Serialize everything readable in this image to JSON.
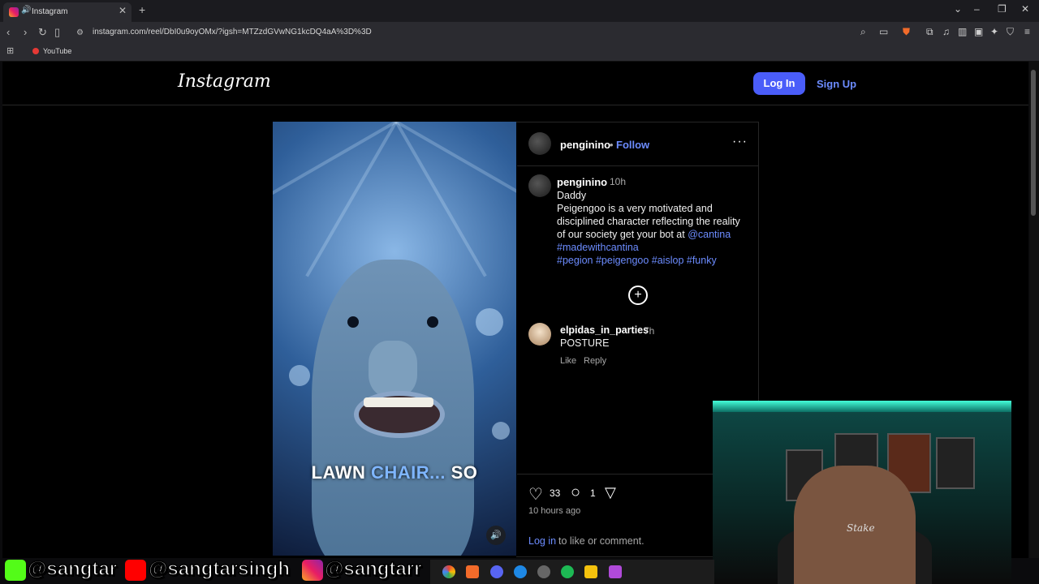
{
  "browser": {
    "tab_title": "Instagram",
    "new_tab": "+",
    "url": "instagram.com/reel/DbI0u9oyOMx/?igsh=MTZzdGVwNG1kcDQ4aA%3D%3D",
    "bookmark": "YouTube"
  },
  "header": {
    "logo": "Instagram",
    "login_label": "Log In",
    "signup_label": "Sign Up"
  },
  "video": {
    "caption_white1": "LAWN",
    "caption_blue": "CHAIR...",
    "caption_white2": "SO",
    "mute_icon": "🔊"
  },
  "post": {
    "author": "penginino",
    "dot": "•",
    "follow_label": "Follow",
    "more_label": "···",
    "caption_user": "penginino",
    "caption_time": "10h",
    "caption_line1": "Daddy",
    "caption_body": "Peigengoo is a very motivated and disciplined character reflecting the reality of our society get your bot at",
    "caption_mention": "@cantina",
    "caption_tag1": "#madewithcantina",
    "caption_tags2": "#pegion #peigengoo #aislop #funky",
    "add_icon": "+",
    "comment_user": "elpidas_in_parties",
    "comment_time": "7h",
    "comment_text": "POSTURE",
    "comment_like": "Like",
    "comment_reply": "Reply",
    "likes": "33",
    "comments": "1",
    "time_ago": "10 hours ago",
    "login_link": "Log in",
    "login_tail": "to like or comment."
  },
  "webcam": {
    "shirt_text": "Stake"
  },
  "overlay": {
    "kick_handle": "@sangtar",
    "youtube_handle": "@sangtarsingh",
    "instagram_handle": "@sangtarr"
  },
  "colors": {
    "accent": "#4a5df9",
    "link": "#6c8cff",
    "background": "#000000"
  }
}
